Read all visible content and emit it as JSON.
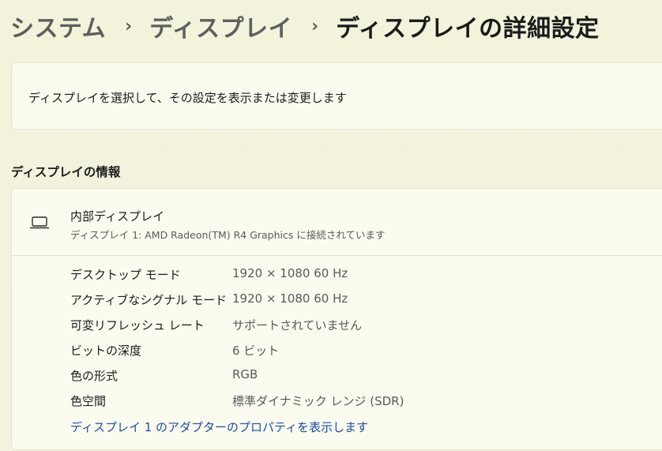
{
  "breadcrumb": {
    "items": [
      "システム",
      "ディスプレイ",
      "ディスプレイの詳細設定"
    ],
    "separator": "›"
  },
  "select_display": {
    "text": "ディスプレイを選択して、その設定を表示または変更します"
  },
  "display_info": {
    "heading": "ディスプレイの情報",
    "icon": "laptop-icon",
    "name": "内部ディスプレイ",
    "subtitle": "ディスプレイ 1: AMD Radeon(TM) R4 Graphics に接続されています",
    "properties": [
      {
        "label": "デスクトップ モード",
        "value": "1920 × 1080 60 Hz"
      },
      {
        "label": "アクティブなシグナル モード",
        "value": "1920 × 1080 60 Hz"
      },
      {
        "label": "可変リフレッシュ レート",
        "value": "サポートされていません"
      },
      {
        "label": "ビットの深度",
        "value": "6 ビット"
      },
      {
        "label": "色の形式",
        "value": "RGB"
      },
      {
        "label": "色空間",
        "value": "標準ダイナミック レンジ (SDR)"
      }
    ],
    "adapter_link": "ディスプレイ 1 のアダプターのプロパティを表示します"
  },
  "colors": {
    "background": "#f3f3dc",
    "card": "#fbfbf0",
    "link": "#1a4fa0"
  }
}
